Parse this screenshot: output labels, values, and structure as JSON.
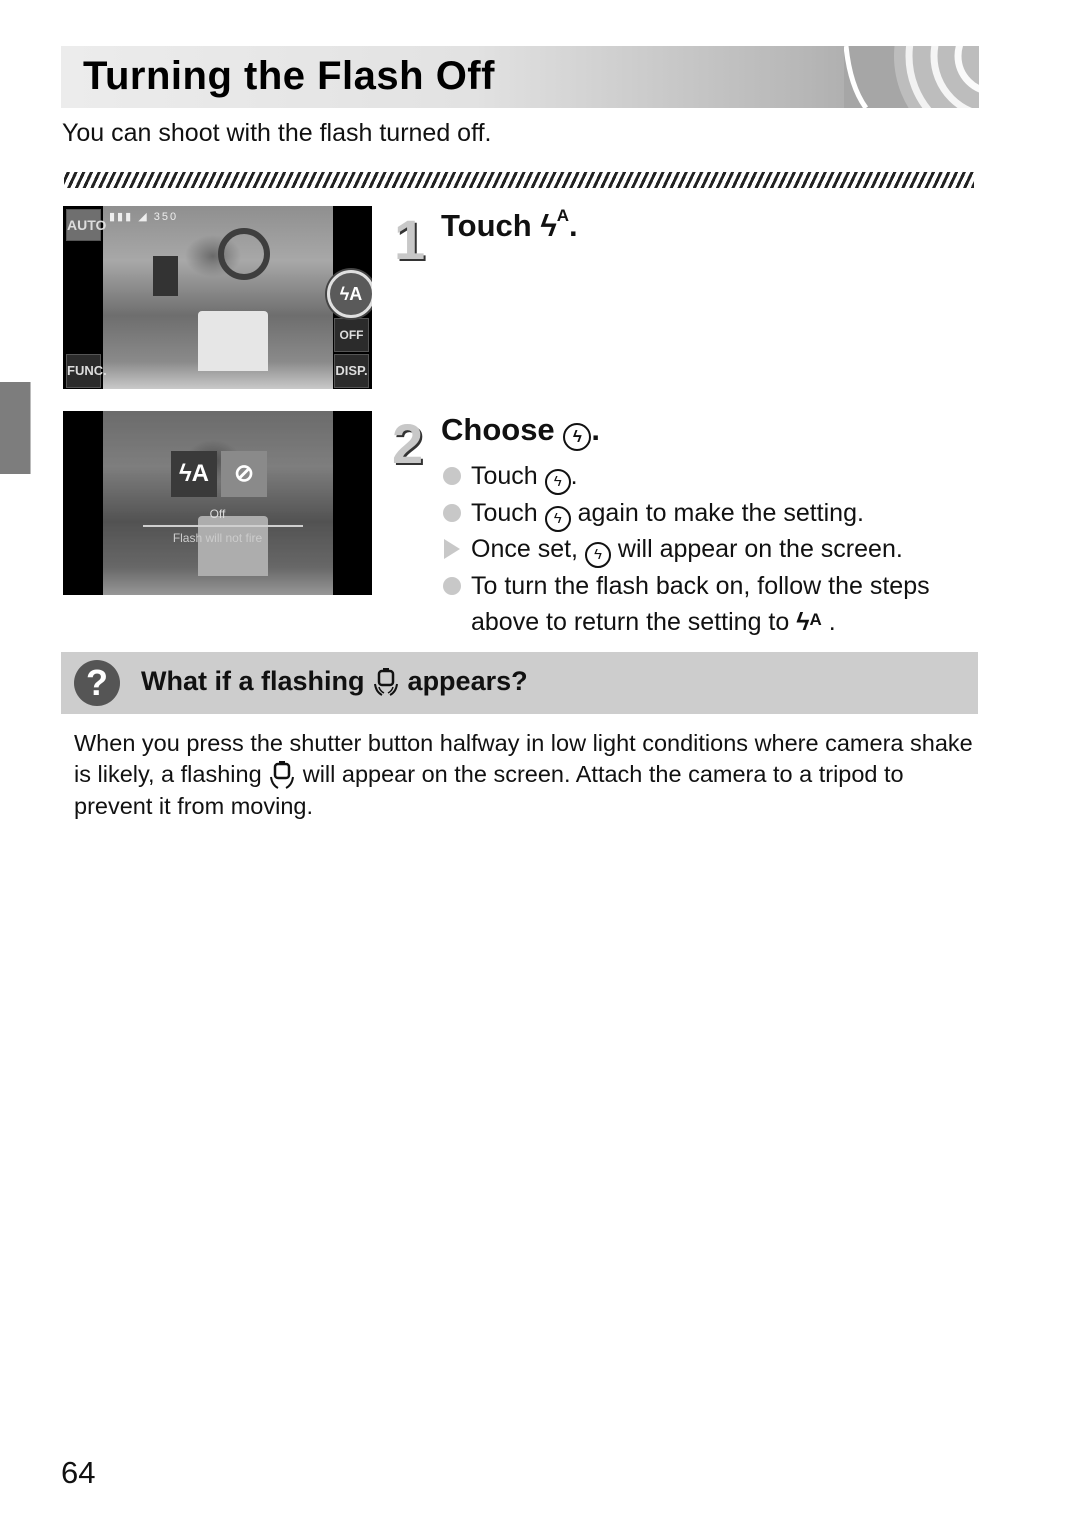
{
  "header": {
    "title": "Turning the Flash Off",
    "intro": "You can shoot with the flash turned off."
  },
  "screenshots": {
    "shot1": {
      "auto_label": "AUTO",
      "status_icons": "▮▮▮ ◢ 350",
      "func_label": "FUNC.",
      "disp_label": "DISP.",
      "off_label": "OFF",
      "flash_label": "ϟA"
    },
    "shot2": {
      "flash_auto_label": "ϟA",
      "flash_off_label": "⊘",
      "mode_name": "Off",
      "mode_desc": "Flash will not fire"
    }
  },
  "steps": [
    {
      "number": "1",
      "heading_prefix": "Touch",
      "heading_icon": "ϟ",
      "heading_icon_sup": "A",
      "heading_suffix": "."
    },
    {
      "number": "2",
      "heading_prefix": "Choose",
      "heading_icon": "ϟ",
      "heading_suffix": ".",
      "bullets": [
        {
          "type": "dot",
          "before": "Touch",
          "after": "."
        },
        {
          "type": "dot",
          "before": "Touch",
          "after": "again to make the setting."
        },
        {
          "type": "arrow",
          "before": "Once set,",
          "after": "will appear on the screen."
        },
        {
          "type": "dot",
          "before": "To turn the flash back on, follow the steps above to return the setting to",
          "icon": "ϟ",
          "icon_sup": "A",
          "after": "."
        }
      ]
    }
  ],
  "faq": {
    "q_icon": "?",
    "title_before": "What if a flashing",
    "title_icon": "camera-shake",
    "title_after": "appears?",
    "body_before": "When you press the shutter button halfway in low light conditions where camera shake is likely, a flashing",
    "body_after": "will appear on the screen. Attach the camera to a tripod to prevent it from moving."
  },
  "page_number": "64",
  "icons": {
    "off_glyph": "ϟ",
    "shake_glyph": "⌂"
  }
}
